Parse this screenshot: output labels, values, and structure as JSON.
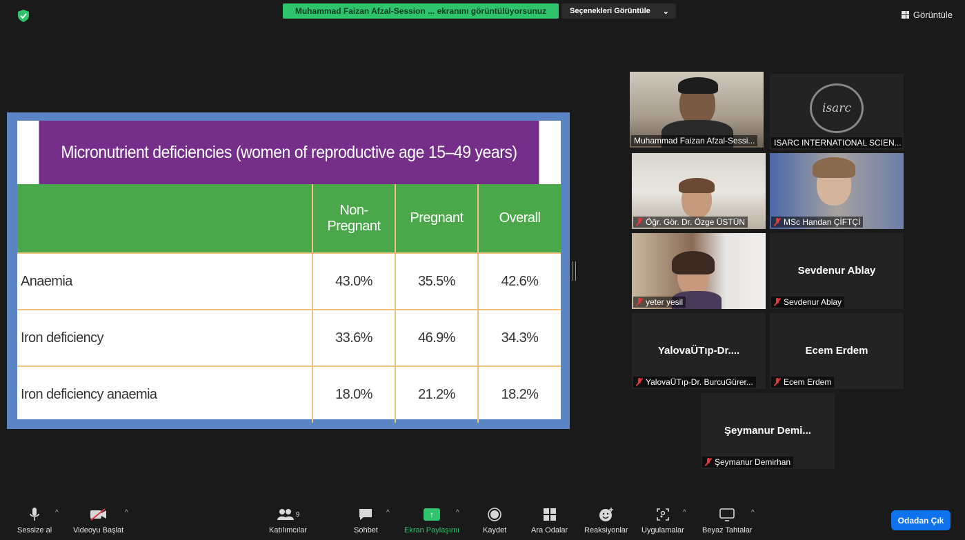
{
  "top": {
    "share_banner": "Muhammad Faizan Afzal-Session ... ekranını görüntülüyorsunuz",
    "view_options": "Seçenekleri Görüntüle",
    "view_button": "Görüntüle"
  },
  "slide": {
    "title": "Micronutrient deficiencies (women of reproductive age 15–49 years)",
    "headers": [
      "",
      "Non-Pregnant",
      "Pregnant",
      "Overall"
    ],
    "rows": [
      {
        "label": "Anaemia",
        "non_pregnant": "43.0%",
        "pregnant": "35.5%",
        "overall": "42.6%"
      },
      {
        "label": "Iron deficiency",
        "non_pregnant": "33.6%",
        "pregnant": "46.9%",
        "overall": "34.3%"
      },
      {
        "label": "Iron deficiency anaemia",
        "non_pregnant": "18.0%",
        "pregnant": "21.2%",
        "overall": "18.2%"
      }
    ]
  },
  "participants": [
    {
      "name": "Muhammad Faizan Afzal-Sessi...",
      "muted": false,
      "video": true
    },
    {
      "name": "ISARC INTERNATIONAL SCIEN...",
      "muted": false,
      "logo_text": "isarc"
    },
    {
      "name": "Öğr. Gör. Dr. Özge ÜSTÜN",
      "muted": true,
      "video": true
    },
    {
      "name": "MSc Handan ÇİFTÇİ",
      "muted": true,
      "video": true
    },
    {
      "name": "yeter yesil",
      "muted": true,
      "video": true
    },
    {
      "name": "Sevdenur Ablay",
      "display": "Sevdenur Ablay",
      "muted": true
    },
    {
      "name": "YalovaÜTıp-Dr. BurcuGürer...",
      "display": "YalovaÜTıp-Dr....",
      "muted": true
    },
    {
      "name": "Ecem Erdem",
      "display": "Ecem Erdem",
      "muted": true
    },
    {
      "name": "Şeymanur Demirhan",
      "display": "Şeymanur  Demi...",
      "muted": true
    }
  ],
  "toolbar": {
    "mute": "Sessize al",
    "video": "Videoyu Başlat",
    "participants": "Katılımcılar",
    "participant_count": "9",
    "chat": "Sohbet",
    "share": "Ekran Paylaşımı",
    "record": "Kaydet",
    "breakout": "Ara Odalar",
    "reactions": "Reaksiyonlar",
    "apps": "Uygulamalar",
    "whiteboard": "Beyaz Tahtalar",
    "leave": "Odadan Çık"
  },
  "colors": {
    "share_green": "#2fc46b",
    "slide_title_bg": "#752f8a",
    "slide_header_bg": "#4ba84a",
    "slide_frame": "#5a84c4",
    "leave_blue": "#0e72ed",
    "active_speaker": "#c9e26a",
    "muted_red": "#e23a3a"
  }
}
